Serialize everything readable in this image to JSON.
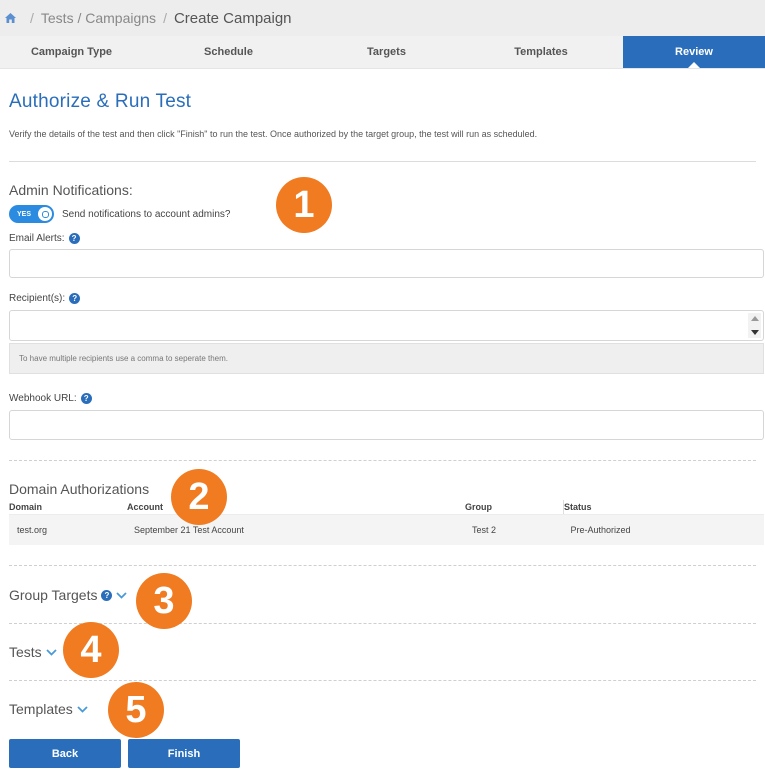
{
  "breadcrumb": {
    "section": "Tests / Campaigns",
    "current": "Create Campaign"
  },
  "steps": [
    "Campaign Type",
    "Schedule",
    "Targets",
    "Templates",
    "Review"
  ],
  "active_step": "Review",
  "title": "Authorize & Run Test",
  "intro": "Verify the details of the test and then click \"Finish\" to run the test. Once authorized by the target group, the test will run as scheduled.",
  "admin": {
    "heading": "Admin Notifications:",
    "toggle_label": "YES",
    "toggle_text": "Send notifications to account admins?",
    "email_label": "Email Alerts:",
    "recipients_label": "Recipient(s):",
    "recipients_hint": "To have multiple recipients use a comma to seperate them.",
    "webhook_label": "Webhook URL:"
  },
  "domains": {
    "heading": "Domain Authorizations",
    "columns": [
      "Domain",
      "Account",
      "Group",
      "Status"
    ],
    "rows": [
      [
        "test.org",
        "September 21 Test Account",
        "Test 2",
        "Pre-Authorized"
      ]
    ]
  },
  "group_targets": "Group Targets",
  "tests": "Tests",
  "templates": "Templates",
  "badges": [
    "1",
    "2",
    "3",
    "4",
    "5"
  ],
  "buttons": {
    "back": "Back",
    "finish": "Finish"
  },
  "colors": {
    "accent": "#2a6ebb",
    "badge": "#f07b21"
  }
}
